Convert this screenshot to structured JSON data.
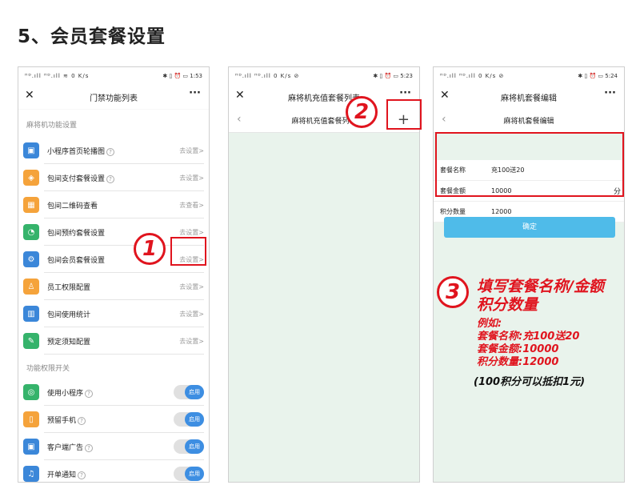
{
  "heading": "5、会员套餐设置",
  "phone1": {
    "status_left": "ᴴᴰ.ıll ᴴᴰ.ıll ≋ 0 K/s",
    "status_right": "✱ ▯ ⏰ ▭ 1:53",
    "nav_title": "门禁功能列表",
    "section1": "麻将机功能设置",
    "items": [
      {
        "label": "小程序首页轮播图",
        "help": true,
        "action": "去设置>",
        "color": "#3b87d9",
        "glyph": "▣"
      },
      {
        "label": "包间支付套餐设置",
        "help": true,
        "action": "去设置>",
        "color": "#f5a33b",
        "glyph": "◈"
      },
      {
        "label": "包间二维码查看",
        "help": false,
        "action": "去查看>",
        "color": "#f5a33b",
        "glyph": "▦"
      },
      {
        "label": "包间预约套餐设置",
        "help": false,
        "action": "去设置>",
        "color": "#35b36b",
        "glyph": "◔"
      },
      {
        "label": "包间会员套餐设置",
        "help": false,
        "action": "去设置>",
        "color": "#3b87d9",
        "glyph": "⚙"
      },
      {
        "label": "员工权限配置",
        "help": false,
        "action": "去设置>",
        "color": "#f5a33b",
        "glyph": "♙"
      },
      {
        "label": "包间使用统计",
        "help": false,
        "action": "去设置>",
        "color": "#3b87d9",
        "glyph": "▥"
      },
      {
        "label": "预定须知配置",
        "help": false,
        "action": "去设置>",
        "color": "#35b36b",
        "glyph": "✎"
      }
    ],
    "section2": "功能权限开关",
    "toggles": [
      {
        "label": "使用小程序",
        "help": true,
        "state": "启用",
        "color": "#35b36b",
        "glyph": "◎"
      },
      {
        "label": "预留手机",
        "help": true,
        "state": "启用",
        "color": "#f5a33b",
        "glyph": "▯"
      },
      {
        "label": "客户端广告",
        "help": true,
        "state": "启用",
        "color": "#3b87d9",
        "glyph": "▣"
      },
      {
        "label": "开单通知",
        "help": true,
        "state": "启用",
        "color": "#3b87d9",
        "glyph": "♫"
      }
    ]
  },
  "phone2": {
    "status_left": "ᴴᴰ.ıll ᴴᴰ.ıll 0 K/s ⊘",
    "status_right": "✱ ▯ ⏰ ▭ 5:23",
    "nav_title": "麻将机充值套餐列表",
    "sub_title": "麻将机充值套餐列表",
    "add": "+"
  },
  "phone3": {
    "status_left": "ᴴᴰ.ıll ᴴᴰ.ıll 0 K/s ⊘",
    "status_right": "✱ ▯ ⏰ ▭ 5:24",
    "nav_title": "麻将机套餐编辑",
    "sub_title": "麻将机套餐编辑",
    "fields": [
      {
        "label": "套餐名称",
        "value": "充100送20",
        "unit": ""
      },
      {
        "label": "套餐金额",
        "value": "10000",
        "unit": "分"
      },
      {
        "label": "积分数量",
        "value": "12000",
        "unit": ""
      }
    ],
    "confirm": "确定"
  },
  "annotations": {
    "step1": "1",
    "step2": "2",
    "step3": "3",
    "step3_line1": "填写套餐名称/金额",
    "step3_line2": "积分数量",
    "ex_title": "例如:",
    "ex1": "套餐名称:充100送20",
    "ex2": "套餐金额:10000",
    "ex3": "积分数量:12000",
    "note": "(100积分可以抵扣1元)"
  }
}
